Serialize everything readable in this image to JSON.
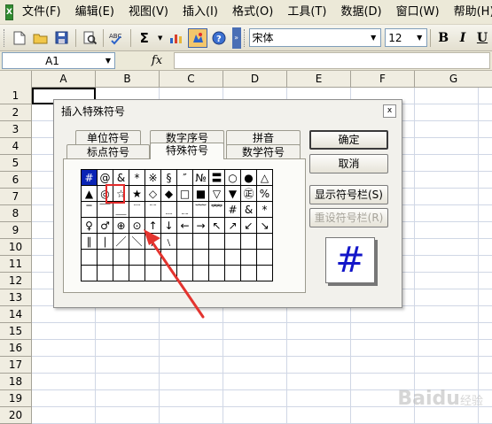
{
  "menubar": {
    "items": [
      "文件(F)",
      "编辑(E)",
      "视图(V)",
      "插入(I)",
      "格式(O)",
      "工具(T)",
      "数据(D)",
      "窗口(W)",
      "帮助(H)"
    ]
  },
  "toolbar": {
    "font_name": "宋体",
    "font_size": "12",
    "bold_label": "B",
    "italic_label": "I",
    "underline_label": "U"
  },
  "formula_bar": {
    "name_box": "A1",
    "fx_label": "fx",
    "formula": ""
  },
  "sheet": {
    "columns": [
      "A",
      "B",
      "C",
      "D",
      "E",
      "F",
      "G"
    ],
    "rows": [
      "1",
      "2",
      "3",
      "4",
      "5",
      "6",
      "7",
      "8",
      "9",
      "10",
      "11",
      "12",
      "13",
      "14",
      "15",
      "16",
      "17",
      "18",
      "19",
      "20"
    ]
  },
  "dialog": {
    "title": "插入特殊符号",
    "close_label": "x",
    "tabs_back": [
      "单位符号",
      "数字序号",
      "拼音"
    ],
    "tabs_front": [
      "标点符号",
      "特殊符号",
      "数学符号"
    ],
    "active_tab": "特殊符号",
    "symbols": [
      [
        "#",
        "@",
        "&",
        "*",
        "※",
        "§",
        "″",
        "№",
        "〓",
        "○",
        "●",
        "△"
      ],
      [
        "▲",
        "◎",
        "☆",
        "★",
        "◇",
        "◆",
        "□",
        "■",
        "▽",
        "▼",
        "㊣",
        "%"
      ],
      [
        "‾",
        "￣",
        "＿",
        "﹉",
        "﹊",
        "﹍",
        "﹎",
        "﹋",
        "﹌",
        "#",
        "&",
        "*"
      ],
      [
        "♀",
        "♂",
        "⊕",
        "⊙",
        "↑",
        "↓",
        "←",
        "→",
        "↖",
        "↗",
        "↙",
        "↘"
      ],
      [
        "∥",
        "∣",
        "／",
        "＼",
        "∕",
        "﹨",
        "",
        "",
        "",
        "",
        "",
        ""
      ],
      [
        "",
        "",
        "",
        "",
        "",
        "",
        "",
        "",
        "",
        "",
        "",
        ""
      ],
      [
        "",
        "",
        "",
        "",
        "",
        "",
        "",
        "",
        "",
        "",
        "",
        ""
      ]
    ],
    "selected_symbol": "#",
    "buttons": {
      "ok": "确定",
      "cancel": "取消",
      "show_bar": "显示符号栏(S)",
      "reset_bar": "重设符号栏(R)"
    },
    "preview_symbol": "#"
  },
  "watermark": {
    "brand": "Baidu",
    "sub": "经验"
  },
  "colors": {
    "window_bg": "#ece9d8",
    "selection_blue": "#0a24b5",
    "highlight_red": "#e22a2a",
    "preview_blue": "#1316c9"
  }
}
